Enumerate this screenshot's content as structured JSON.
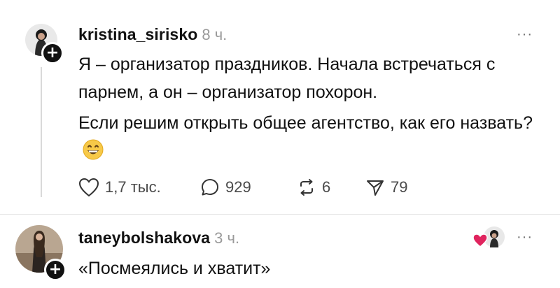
{
  "post": {
    "username": "kristina_sirisko",
    "time": "8 ч.",
    "more": "···",
    "paragraphs": [
      "Я – организатор праздников. Начала встречаться с парнем, а он – организатор похорон.",
      "Если решим открыть общее агентство, как его назвать?"
    ],
    "emoji": "grinning-face-emoji",
    "actions": {
      "likes": "1,7 тыс.",
      "comments": "929",
      "reposts": "6",
      "shares": "79"
    }
  },
  "reply": {
    "username": "taneybolshakova",
    "time": "3 ч.",
    "more": "···",
    "text": "«Посмеялись и хватит»"
  },
  "colors": {
    "text": "#111111",
    "muted": "#9a9a9a",
    "heart": "#e0245e"
  }
}
